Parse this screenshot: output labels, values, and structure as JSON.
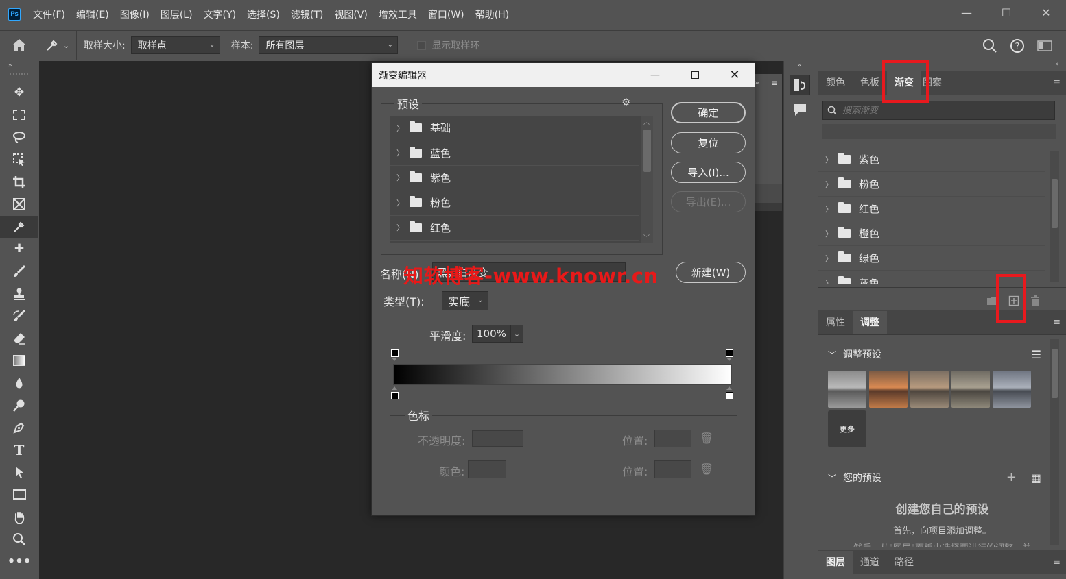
{
  "app": {
    "logo": "Ps"
  },
  "menu": [
    "文件(F)",
    "编辑(E)",
    "图像(I)",
    "图层(L)",
    "文字(Y)",
    "选择(S)",
    "滤镜(T)",
    "视图(V)",
    "增效工具",
    "窗口(W)",
    "帮助(H)"
  ],
  "window_controls": {
    "minimize": "—",
    "maximize": "☐",
    "close": "✕"
  },
  "options_bar": {
    "sample_size_label": "取样大小:",
    "sample_size_value": "取样点",
    "sample_label": "样本:",
    "sample_value": "所有图层",
    "show_ring_label": "显示取样环"
  },
  "right_tabs_top": [
    "颜色",
    "色板",
    "渐变",
    "图案"
  ],
  "gradient_panel": {
    "search_placeholder": "搜索渐变",
    "folders": [
      "紫色",
      "粉色",
      "红色",
      "橙色",
      "绿色",
      "灰色"
    ]
  },
  "adjust_tabs": [
    "属性",
    "调整"
  ],
  "adjust_panel": {
    "presets_title": "调整预设",
    "more_label": "更多",
    "your_presets_title": "您的预设",
    "create_title": "创建您自己的预设",
    "create_sub": "首先，向项目添加调整。",
    "create_sub2": "然后，从\"图层\"面板中选择要进行的调整，并"
  },
  "layer_tabs": [
    "图层",
    "通道",
    "路径"
  ],
  "dialog": {
    "title": "渐变编辑器",
    "presets_label": "预设",
    "presets": [
      "基础",
      "蓝色",
      "紫色",
      "粉色",
      "红色"
    ],
    "buttons": {
      "ok": "确定",
      "reset": "复位",
      "import": "导入(I)...",
      "export": "导出(E)...",
      "new": "新建(W)"
    },
    "name_label": "名称(N):",
    "name_value": "黑，白渐变",
    "type_label": "类型(T):",
    "type_value": "实底",
    "smoothness_label": "平滑度:",
    "smoothness_value": "100%",
    "stops_label": "色标",
    "opacity_label": "不透明度:",
    "position_label": "位置:",
    "color_label": "颜色:",
    "delete_icon": "🗑"
  },
  "watermark": "知软博客-www.knowr.cn",
  "colors": {
    "highlight": "#e8191e",
    "watermark": "#e81919",
    "panel": "#535353",
    "canvas": "#282828"
  }
}
